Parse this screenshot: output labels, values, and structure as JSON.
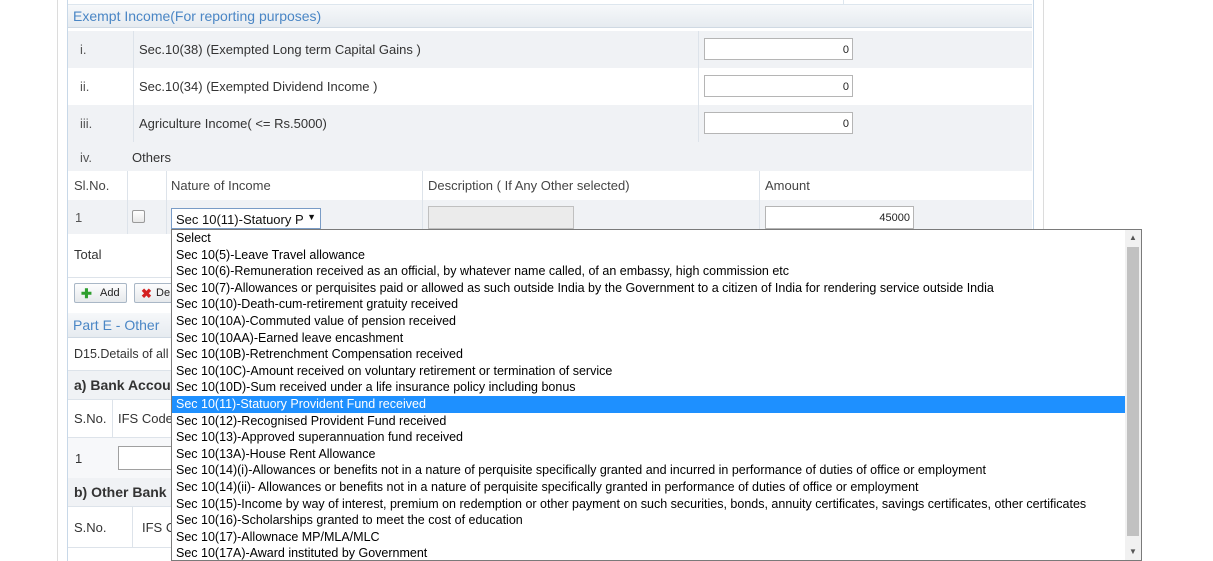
{
  "exempt": {
    "title": "Exempt Income(For reporting purposes)",
    "rows": [
      {
        "num": "i.",
        "label": "Sec.10(38) (Exempted Long term Capital Gains )",
        "value": "0"
      },
      {
        "num": "ii.",
        "label": "Sec.10(34) (Exempted Dividend Income )",
        "value": "0"
      },
      {
        "num": "iii.",
        "label": "Agriculture Income( <= Rs.5000)",
        "value": "0"
      }
    ],
    "others": {
      "num": "iv.",
      "label": "Others"
    },
    "columns": {
      "sl": "Sl.No.",
      "nature": "Nature of Income",
      "desc": "Description ( If Any Other selected)",
      "amount": "Amount"
    },
    "entry": {
      "sl": "1",
      "selected": "Sec 10(11)-Statuory P",
      "amount": "45000"
    },
    "total_label": "Total",
    "add_label": "Add",
    "delete_label": "De"
  },
  "part_e": {
    "title": "Part E - Other",
    "d15": "D15.Details of all",
    "bank_a": "a) Bank Accou",
    "sno": "S.No.",
    "ifs": "IFS Code",
    "row1": "1",
    "bank_b": "b) Other Bank",
    "sno_b": "S.No.",
    "ifs_b": "IFS C"
  },
  "dropdown": {
    "selected_index": 10,
    "options": [
      "Select",
      "Sec 10(5)-Leave Travel allowance",
      "Sec 10(6)-Remuneration received as an official, by whatever name called, of an embassy, high commission etc",
      "Sec 10(7)-Allowances or perquisites paid or allowed as such outside India by the Government to a citizen of India for rendering service outside India",
      "Sec 10(10)-Death-cum-retirement gratuity received",
      "Sec 10(10A)-Commuted value of pension received",
      "Sec 10(10AA)-Earned leave encashment",
      "Sec 10(10B)-Retrenchment Compensation received",
      "Sec 10(10C)-Amount received on voluntary retirement or termination of service",
      "Sec 10(10D)-Sum received under a life insurance policy including bonus",
      "Sec 10(11)-Statuory Provident Fund received",
      "Sec 10(12)-Recognised Provident Fund received",
      "Sec 10(13)-Approved superannuation fund received",
      "Sec 10(13A)-House Rent Allowance",
      "Sec 10(14)(i)-Allowances or benefits not in a nature of perquisite specifically granted and incurred in performance of duties of office or employment",
      "Sec 10(14)(ii)- Allowances or benefits not in a nature of perquisite specifically granted in performance of duties of office or employment",
      "Sec 10(15)-Income by way of interest, premium on redemption or other payment on such securities, bonds, annuity certificates, savings certificates, other certificates",
      "Sec 10(16)-Scholarships granted to meet the cost of education",
      "Sec 10(17)-Allownace MP/MLA/MLC",
      "Sec 10(17A)-Award instituted by Government"
    ]
  },
  "icons": {
    "add": "plus-icon",
    "delete": "x-icon",
    "select_arrow": "triangle-down-icon",
    "scroll_up": "triangle-up-icon",
    "scroll_down": "triangle-down-icon"
  },
  "colors": {
    "accent": "#4a86c5",
    "selected_option": "#1e90ff"
  }
}
